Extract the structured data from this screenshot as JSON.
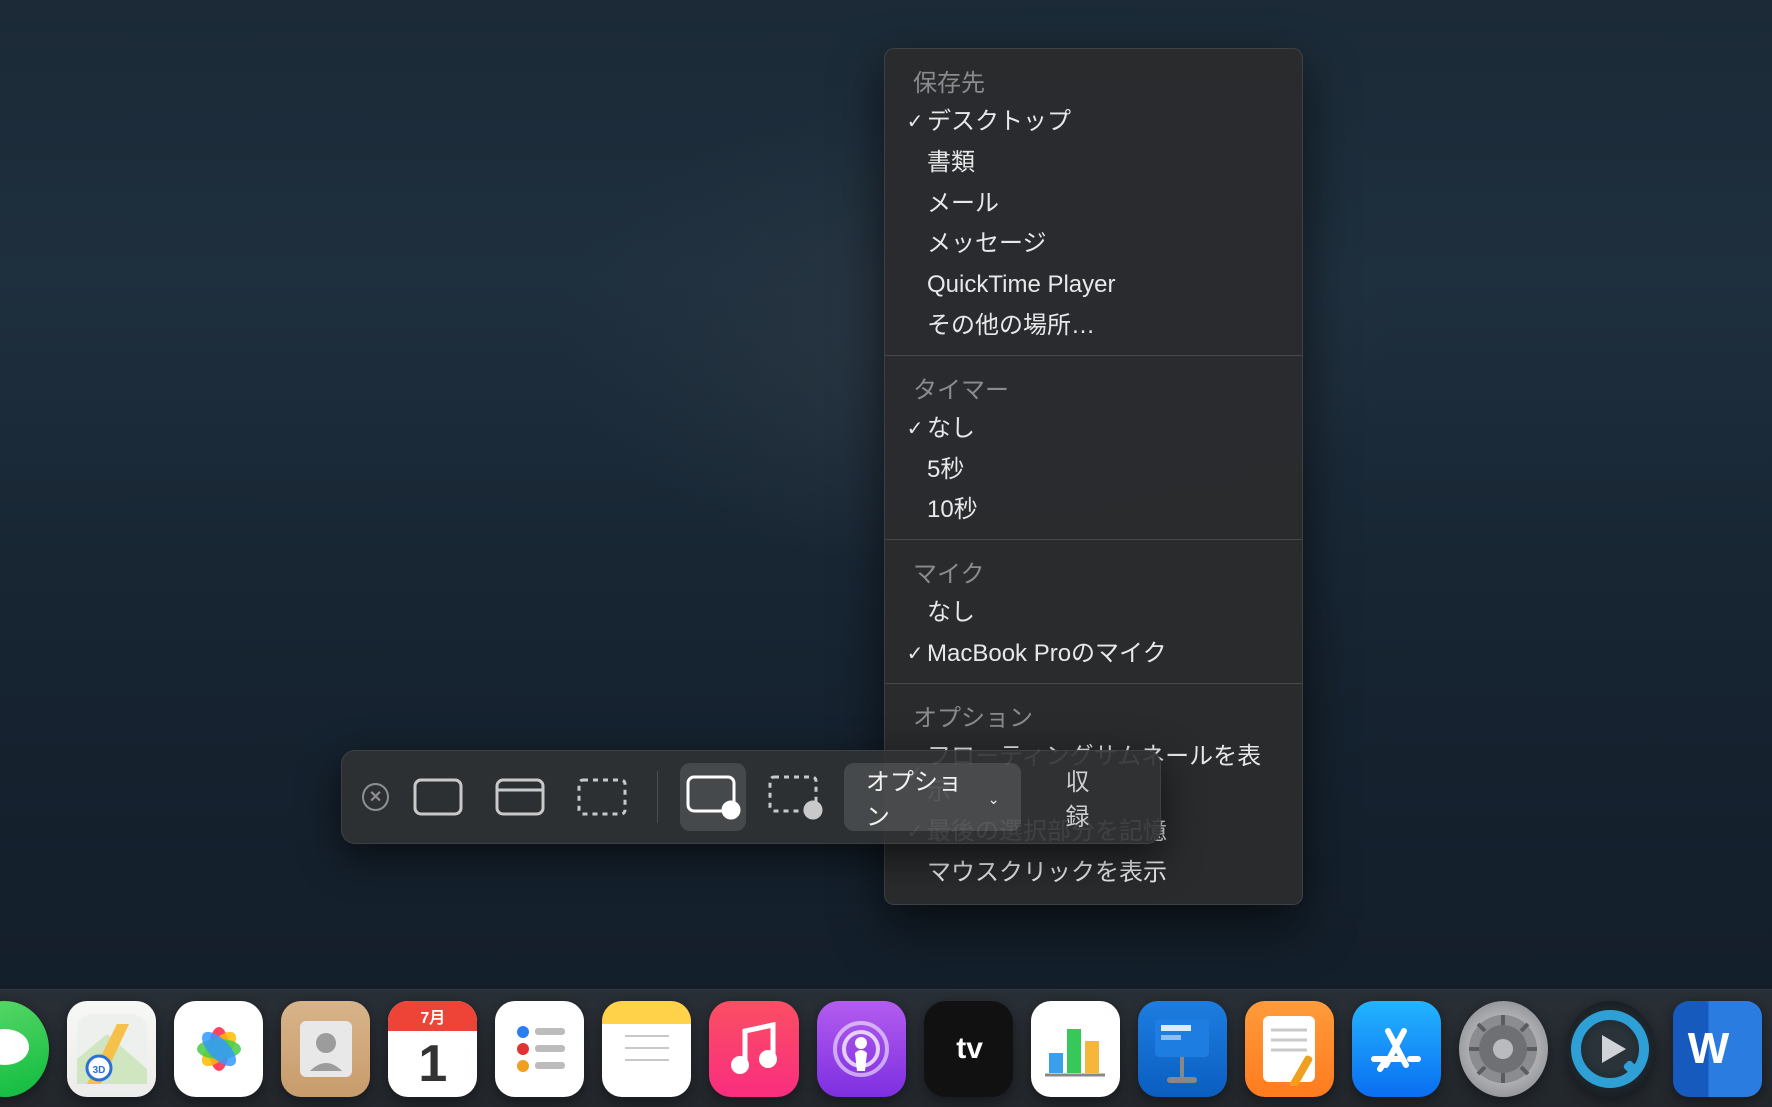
{
  "toolbar": {
    "options_label": "オプション",
    "capture_label": "収録"
  },
  "menu": {
    "sections": [
      {
        "header": "保存先",
        "items": [
          {
            "label": "デスクトップ",
            "checked": true
          },
          {
            "label": "書類",
            "checked": false
          },
          {
            "label": "メール",
            "checked": false
          },
          {
            "label": "メッセージ",
            "checked": false
          },
          {
            "label": "QuickTime Player",
            "checked": false
          },
          {
            "label": "その他の場所…",
            "checked": false
          }
        ]
      },
      {
        "header": "タイマー",
        "items": [
          {
            "label": "なし",
            "checked": true
          },
          {
            "label": "5秒",
            "checked": false
          },
          {
            "label": "10秒",
            "checked": false
          }
        ]
      },
      {
        "header": "マイク",
        "items": [
          {
            "label": "なし",
            "checked": false
          },
          {
            "label": "MacBook Proのマイク",
            "checked": true
          }
        ]
      },
      {
        "header": "オプション",
        "items": [
          {
            "label": "フローティングサムネールを表示",
            "checked": true
          },
          {
            "label": "最後の選択部分を記憶",
            "checked": true
          },
          {
            "label": "マウスクリックを表示",
            "checked": false
          }
        ]
      }
    ]
  },
  "calendar": {
    "month": "7月",
    "day": "1"
  },
  "dock": {
    "tv_label": "tv",
    "word_label": "W"
  }
}
